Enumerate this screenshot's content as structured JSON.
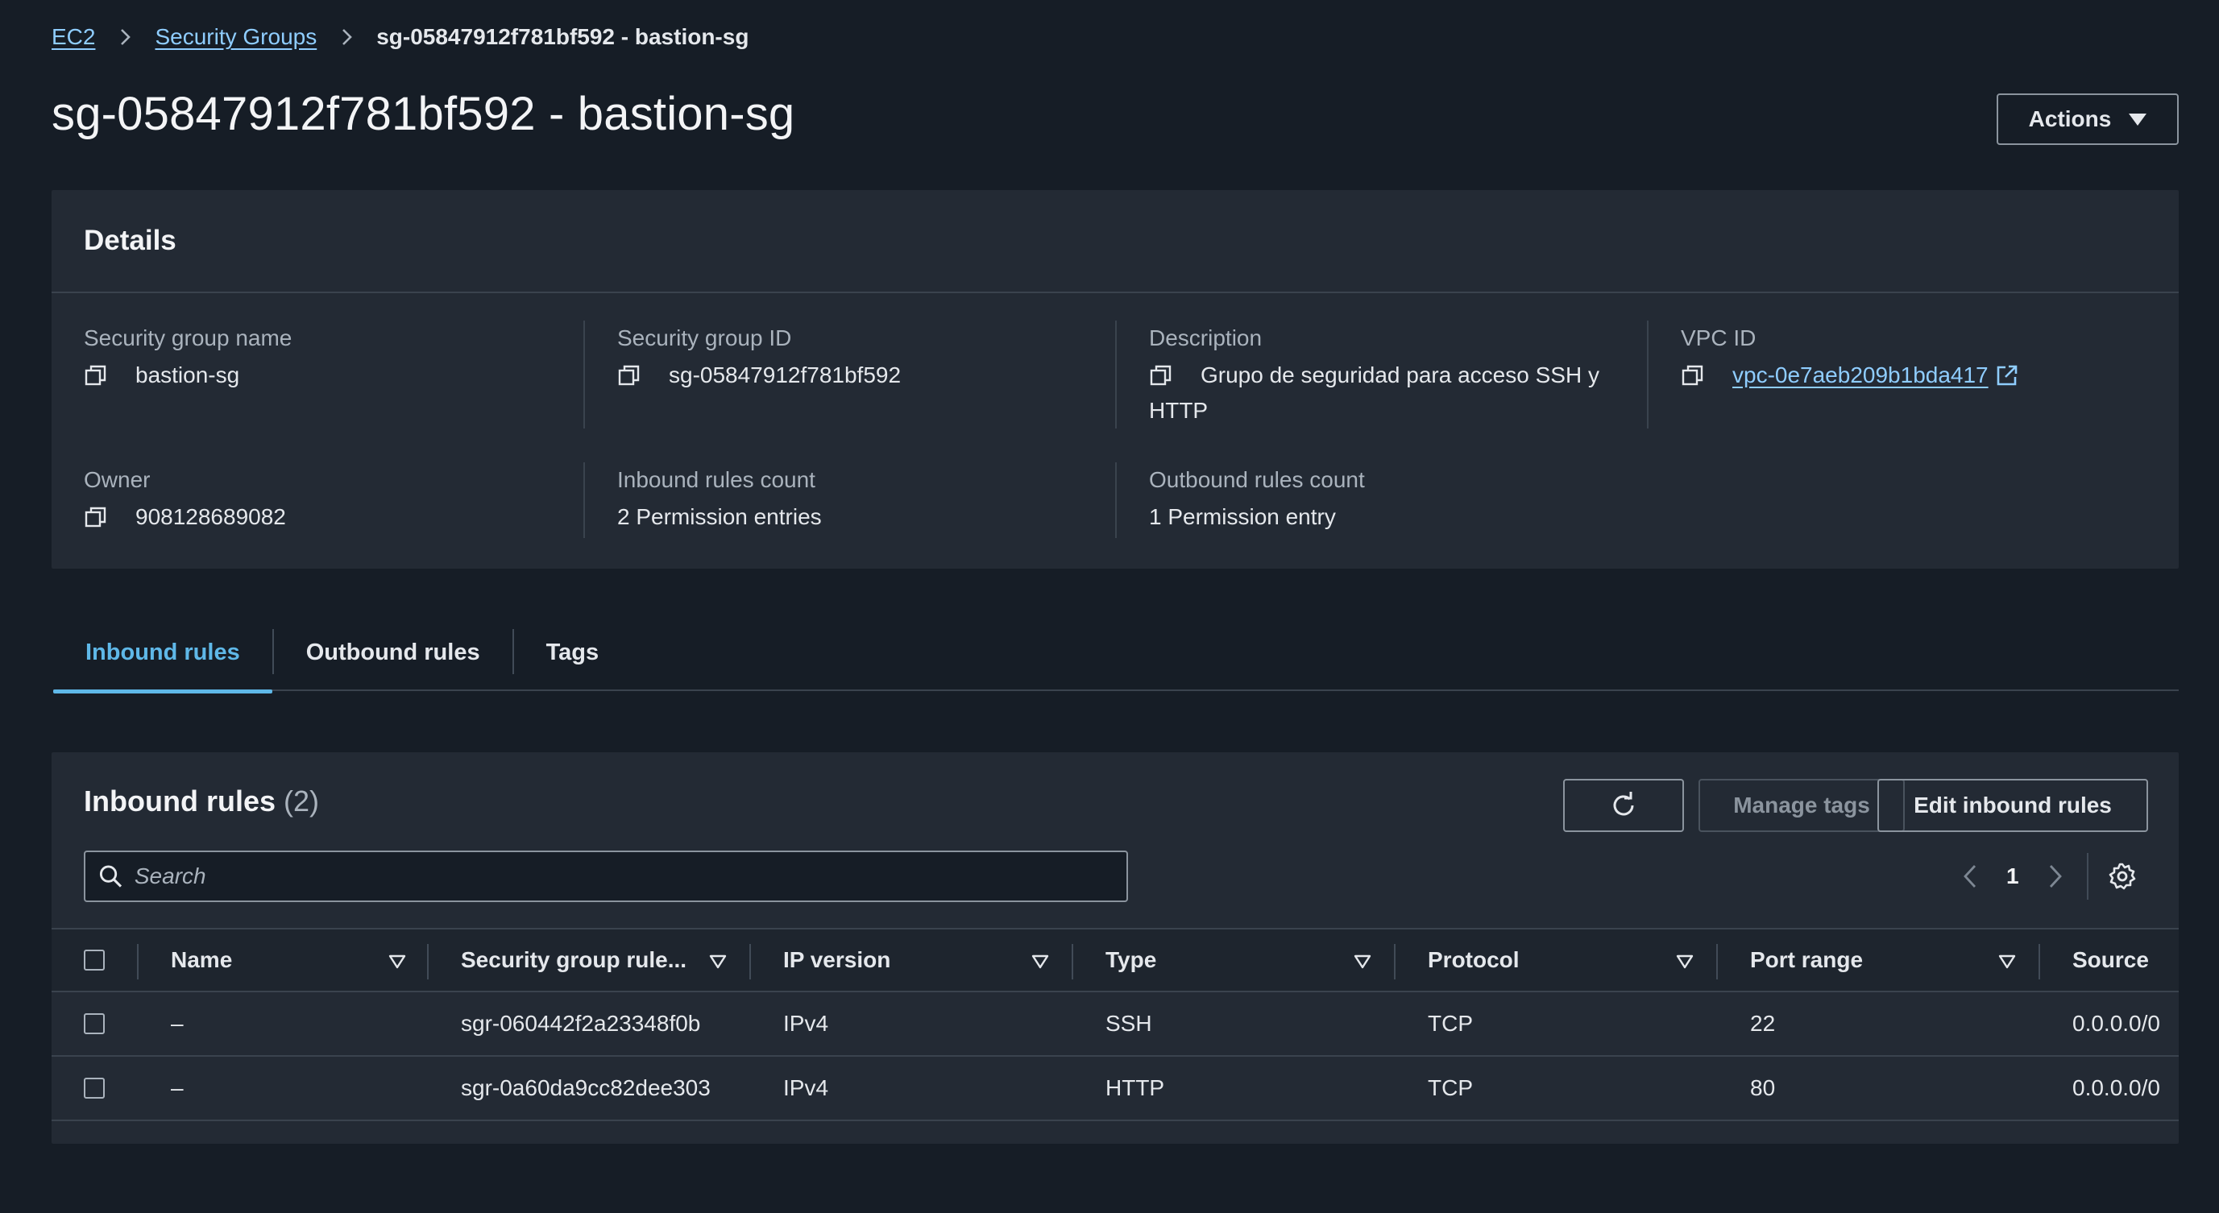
{
  "breadcrumb": {
    "items": [
      "EC2",
      "Security Groups"
    ],
    "current": "sg-05847912f781bf592 - bastion-sg"
  },
  "page_title": "sg-05847912f781bf592 - bastion-sg",
  "actions_label": "Actions",
  "details": {
    "heading": "Details",
    "name_label": "Security group name",
    "name_value": "bastion-sg",
    "id_label": "Security group ID",
    "id_value": "sg-05847912f781bf592",
    "description_label": "Description",
    "description_value": "Grupo de seguridad para acceso SSH y HTTP",
    "vpc_label": "VPC ID",
    "vpc_value": "vpc-0e7aeb209b1bda417",
    "owner_label": "Owner",
    "owner_value": "908128689082",
    "inbound_count_label": "Inbound rules count",
    "inbound_count_value": "2 Permission entries",
    "outbound_count_label": "Outbound rules count",
    "outbound_count_value": "1 Permission entry"
  },
  "tabs": [
    {
      "label": "Inbound rules",
      "active": true
    },
    {
      "label": "Outbound rules",
      "active": false
    },
    {
      "label": "Tags",
      "active": false
    }
  ],
  "rules": {
    "title": "Inbound rules",
    "count": "(2)",
    "manage_tags_label": "Manage tags",
    "edit_label": "Edit inbound rules",
    "search_placeholder": "Search",
    "page": "1",
    "columns": [
      "Name",
      "Security group rule...",
      "IP version",
      "Type",
      "Protocol",
      "Port range",
      "Source"
    ],
    "rows": [
      {
        "name": "–",
        "rule_id": "sgr-060442f2a23348f0b",
        "ip_version": "IPv4",
        "type": "SSH",
        "protocol": "TCP",
        "port_range": "22",
        "source": "0.0.0.0/0"
      },
      {
        "name": "–",
        "rule_id": "sgr-0a60da9cc82dee303",
        "ip_version": "IPv4",
        "type": "HTTP",
        "protocol": "TCP",
        "port_range": "80",
        "source": "0.0.0.0/0"
      }
    ]
  },
  "colors": {
    "background": "#161d26",
    "panel": "#232a34",
    "link": "#8fcdff",
    "active_tab": "#5fb8e8"
  },
  "icons": [
    "chevron-right-icon",
    "caret-down-icon",
    "copy-icon",
    "external-link-icon",
    "refresh-icon",
    "search-icon",
    "chevron-left-icon",
    "gear-icon",
    "sort-filter-icon"
  ]
}
